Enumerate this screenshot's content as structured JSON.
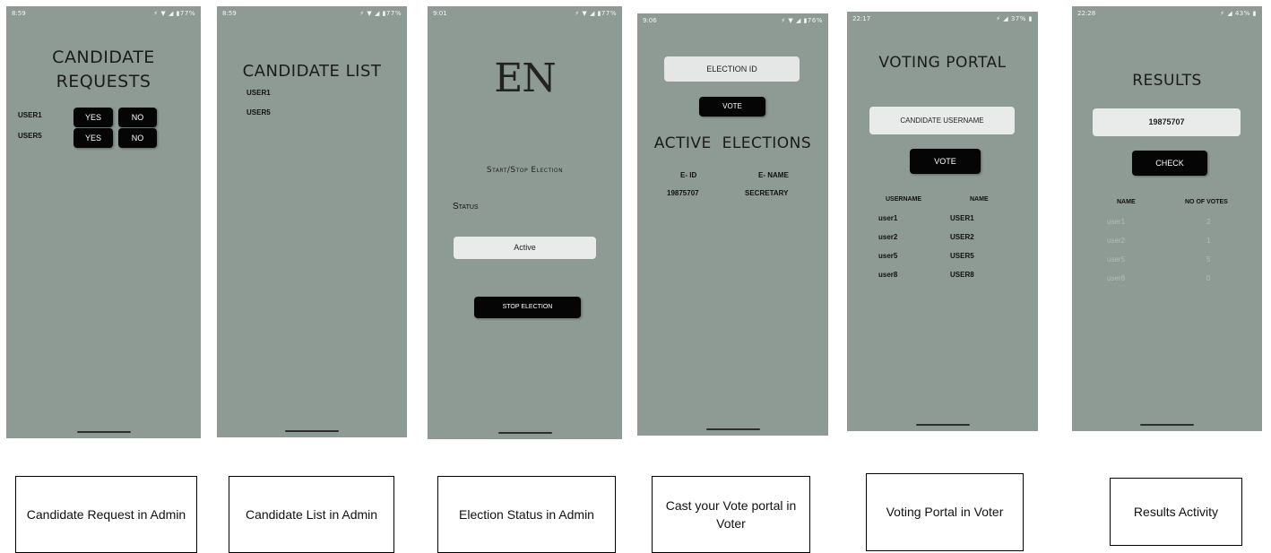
{
  "screens": [
    {
      "status_time": "8:59",
      "status_icons": "⚡ ▼ ◢ ▮77%",
      "title_line1": "CANDIDATE",
      "title_line2": "REQUESTS",
      "rows": [
        {
          "user": "USER1",
          "yes": "YES",
          "no": "NO"
        },
        {
          "user": "USER5",
          "yes": "YES",
          "no": "NO"
        }
      ],
      "caption": "Candidate Request in Admin"
    },
    {
      "status_time": "8:59",
      "status_icons": "⚡ ▼ ◢ ▮77%",
      "title": "CANDIDATE LIST",
      "users": [
        "USER1",
        "USER5"
      ],
      "caption": "Candidate List in Admin"
    },
    {
      "status_time": "9:01",
      "status_icons": "⚡ ▼ ◢ ▮77%",
      "logo": "EN",
      "heading": "Start/Stop Election",
      "status_label": "Status",
      "status_value": "Active",
      "stop_button": "STOP ELECTION",
      "caption": "Election Status in Admin"
    },
    {
      "status_time": "9:06",
      "status_icons": "⚡ ▼ ◢ ▮76%",
      "election_id_placeholder": "ELECTION ID",
      "vote_button": "VOTE",
      "active_title": "ACTIVE  ELECTIONS",
      "col_eid": "E- ID",
      "col_ename": "E- NAME",
      "elections": [
        {
          "eid": "19875707",
          "ename": "SECRETARY"
        }
      ],
      "caption": "Cast your Vote portal in Voter"
    },
    {
      "status_time": "22:17",
      "status_icons": "⚡ ◢ 37% ▮",
      "title": "VOTING PORTAL",
      "candidate_placeholder": "CANDIDATE USERNAME",
      "vote_button": "VOTE",
      "col_username": "USERNAME",
      "col_name": "NAME",
      "rows": [
        {
          "username": "user1",
          "name": "USER1"
        },
        {
          "username": "user2",
          "name": "USER2"
        },
        {
          "username": "user5",
          "name": "USER5"
        },
        {
          "username": "user8",
          "name": "USER8"
        }
      ],
      "caption": "Voting Portal in Voter"
    },
    {
      "status_time": "22:28",
      "status_icons": "⚡ ◢ 43% ▮",
      "title": "RESULTS",
      "election_value": "19875707",
      "check_button": "CHECK",
      "col_name": "NAME",
      "col_votes": "NO OF VOTES",
      "rows": [
        {
          "name": "user1",
          "votes": "2"
        },
        {
          "name": "user2",
          "votes": "1"
        },
        {
          "name": "user5",
          "votes": "5"
        },
        {
          "name": "user8",
          "votes": "0"
        }
      ],
      "caption": "Results Activity"
    }
  ]
}
